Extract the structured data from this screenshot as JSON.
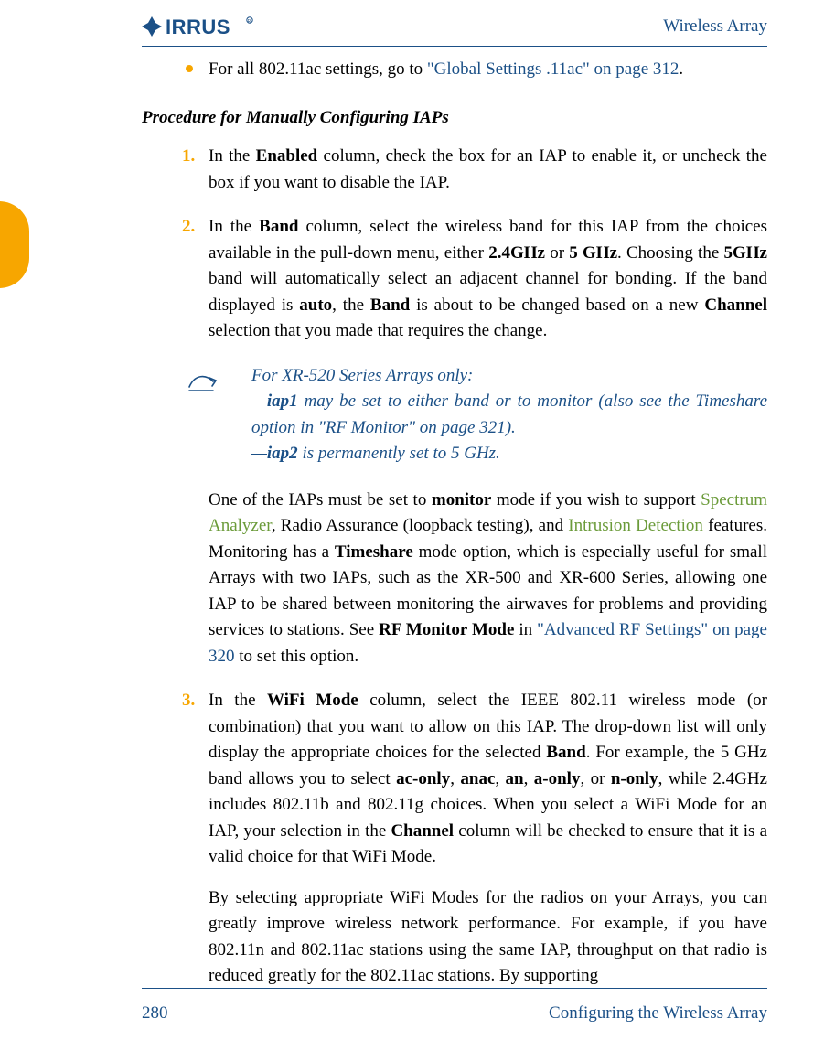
{
  "header": {
    "brand": "XIRRUS",
    "title": "Wireless Array"
  },
  "intro": {
    "prefix": "For all 802.11ac settings, go to ",
    "link": "\"Global Settings .11ac\" on page 312",
    "suffix": "."
  },
  "procedure_heading": "Procedure for Manually Configuring IAPs",
  "steps": {
    "s1": {
      "num": "1.",
      "a": "In the ",
      "b": "Enabled",
      "c": " column, check the box for an IAP to enable it, or uncheck the box if you want to disable the IAP."
    },
    "s2": {
      "num": "2.",
      "a": "In the ",
      "b": "Band",
      "c": " column, select the wireless band for this IAP from the choices available in the pull-down menu, either ",
      "d": "2.4GHz",
      "e": " or ",
      "f": "5 GHz",
      "g": ". Choosing the ",
      "h": "5GHz",
      "i": " band will automatically select an adjacent channel for bonding. If the band displayed is ",
      "j": "auto",
      "k": ", the ",
      "l": "Band",
      "m": " is about to be changed based on a new ",
      "n": "Channel",
      "o": " selection that you made that requires the change."
    },
    "note": {
      "l1": "For XR-520 Series Arrays only:",
      "l2a": "—",
      "l2b": "iap1",
      "l2c": " may be set to either band or to monitor (also see the Timeshare option in \"RF Monitor\" on page 321).",
      "l3a": "—",
      "l3b": "iap2",
      "l3c": " is permanently set to 5 GHz."
    },
    "s2b": {
      "a": "One of the IAPs must be set to ",
      "b": "monitor",
      "c": " mode if you wish to support ",
      "d": "Spectrum Analyzer",
      "e": ", Radio Assurance (loopback testing), and ",
      "f": "Intrusion Detection",
      "g": " features. Monitoring has a ",
      "h": "Timeshare",
      "i": " mode option, which is especially useful for small Arrays with two IAPs, such as the XR-500 and XR-600 Series, allowing one IAP to be shared between monitoring the airwaves for problems and providing services to stations. See ",
      "j": "RF Monitor Mode",
      "k": " in ",
      "l": "\"Advanced RF Settings\" on page 320",
      "m": " to set this option."
    },
    "s3": {
      "num": "3.",
      "a": "In the ",
      "b": "WiFi Mode",
      "c": " column, select the IEEE 802.11 wireless mode (or combination) that you want to allow on this IAP. The drop-down list will only display the appropriate choices for the selected ",
      "d": "Band",
      "e": ". For example, the 5 GHz band allows you to select ",
      "f": "ac-only",
      "g": ", ",
      "h": "anac",
      "i": ", ",
      "j": "an",
      "k": ", ",
      "l": "a-only",
      "m": ", or ",
      "n": "n-only",
      "o": ", while 2.4GHz includes 802.11b and 802.11g choices. When you select a WiFi Mode for an IAP, your selection in the ",
      "p": "Channel",
      "q": " column will be checked to ensure that it is a valid choice for that WiFi Mode."
    },
    "s3b": {
      "a": "By selecting appropriate WiFi Modes for the radios on your Arrays, you can greatly improve wireless network performance. For example, if you have 802.11n and 802.11ac stations using the same IAP, throughput on that radio is reduced greatly for the 802.11ac stations. By supporting"
    }
  },
  "footer": {
    "page": "280",
    "section": "Configuring the Wireless Array"
  }
}
